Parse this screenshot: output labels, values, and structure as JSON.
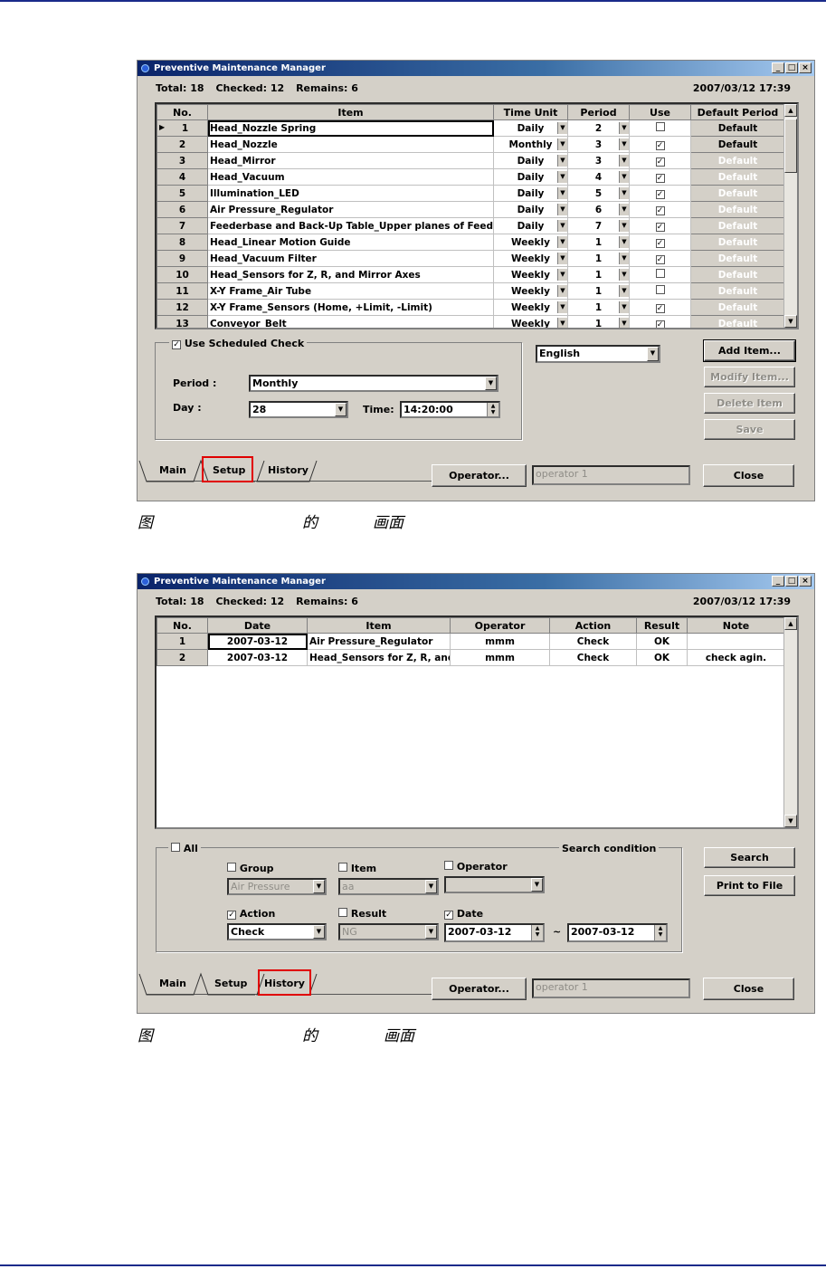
{
  "window_title": "Preventive Maintenance Manager",
  "stats": {
    "total": "Total: 18",
    "checked": "Checked: 12",
    "remains": "Remains: 6"
  },
  "clock": "2007/03/12 17:39",
  "setup": {
    "columns": [
      "No.",
      "Item",
      "Time Unit",
      "Period",
      "Use",
      "Default Period"
    ],
    "rows": [
      {
        "no": "1",
        "item": "Head_Nozzle Spring",
        "unit": "Daily",
        "period": "2",
        "use": false,
        "dp": "Default",
        "dp_active": true
      },
      {
        "no": "2",
        "item": "Head_Nozzle",
        "unit": "Monthly",
        "period": "3",
        "use": true,
        "dp": "Default",
        "dp_active": true
      },
      {
        "no": "3",
        "item": "Head_Mirror",
        "unit": "Daily",
        "period": "3",
        "use": true,
        "dp": "Default",
        "dp_active": false
      },
      {
        "no": "4",
        "item": "Head_Vacuum",
        "unit": "Daily",
        "period": "4",
        "use": true,
        "dp": "Default",
        "dp_active": false
      },
      {
        "no": "5",
        "item": "Illumination_LED",
        "unit": "Daily",
        "period": "5",
        "use": true,
        "dp": "Default",
        "dp_active": false
      },
      {
        "no": "6",
        "item": "Air Pressure_Regulator",
        "unit": "Daily",
        "period": "6",
        "use": true,
        "dp": "Default",
        "dp_active": false
      },
      {
        "no": "7",
        "item": "Feederbase and Back-Up Table_Upper planes of Feeder!",
        "unit": "Daily",
        "period": "7",
        "use": true,
        "dp": "Default",
        "dp_active": false
      },
      {
        "no": "8",
        "item": "Head_Linear Motion Guide",
        "unit": "Weekly",
        "period": "1",
        "use": true,
        "dp": "Default",
        "dp_active": false
      },
      {
        "no": "9",
        "item": "Head_Vacuum Filter",
        "unit": "Weekly",
        "period": "1",
        "use": true,
        "dp": "Default",
        "dp_active": false
      },
      {
        "no": "10",
        "item": "Head_Sensors for Z, R, and Mirror Axes",
        "unit": "Weekly",
        "period": "1",
        "use": false,
        "dp": "Default",
        "dp_active": false
      },
      {
        "no": "11",
        "item": "X-Y Frame_Air Tube",
        "unit": "Weekly",
        "period": "1",
        "use": false,
        "dp": "Default",
        "dp_active": false
      },
      {
        "no": "12",
        "item": "X-Y Frame_Sensors (Home, +Limit, -Limit)",
        "unit": "Weekly",
        "period": "1",
        "use": true,
        "dp": "Default",
        "dp_active": false
      },
      {
        "no": "13",
        "item": "Conveyor_Belt",
        "unit": "Weekly",
        "period": "1",
        "use": true,
        "dp": "Default",
        "dp_active": false
      }
    ],
    "scheduled_label": "Use Scheduled Check",
    "period_label": "Period :",
    "period_value": "Monthly",
    "day_label": "Day :",
    "day_value": "28",
    "time_label": "Time:",
    "time_value": "14:20:00",
    "language": "English",
    "buttons": {
      "add": "Add Item...",
      "modify": "Modify Item...",
      "delete": "Delete Item",
      "save": "Save"
    }
  },
  "history": {
    "columns": [
      "No.",
      "Date",
      "Item",
      "Operator",
      "Action",
      "Result",
      "Note"
    ],
    "rows": [
      {
        "no": "1",
        "date": "2007-03-12",
        "item": "Air Pressure_Regulator",
        "operator": "mmm",
        "action": "Check",
        "result": "OK",
        "note": ""
      },
      {
        "no": "2",
        "date": "2007-03-12",
        "item": "Head_Sensors for Z, R, and",
        "operator": "mmm",
        "action": "Check",
        "result": "OK",
        "note": "check agin."
      }
    ],
    "all_label": "All",
    "search_condition": "Search condition",
    "group_label": "Group",
    "group_value": "Air Pressure",
    "item_label": "Item",
    "item_value": "aa",
    "operator_label": "Operator",
    "operator_value": "",
    "action_label": "Action",
    "action_value": "Check",
    "result_label": "Result",
    "result_value": "NG",
    "date_label": "Date",
    "date_from": "2007-03-12",
    "date_sep": "~",
    "date_to": "2007-03-12",
    "search_button": "Search",
    "print_button": "Print to File"
  },
  "tabs": [
    "Main",
    "Setup",
    "History"
  ],
  "operator_button": "Operator...",
  "operator_field": "operator 1",
  "close_button": "Close",
  "captions": {
    "c1": [
      "图",
      "的",
      "画面"
    ],
    "c2": [
      "图",
      "的",
      "画面"
    ]
  }
}
